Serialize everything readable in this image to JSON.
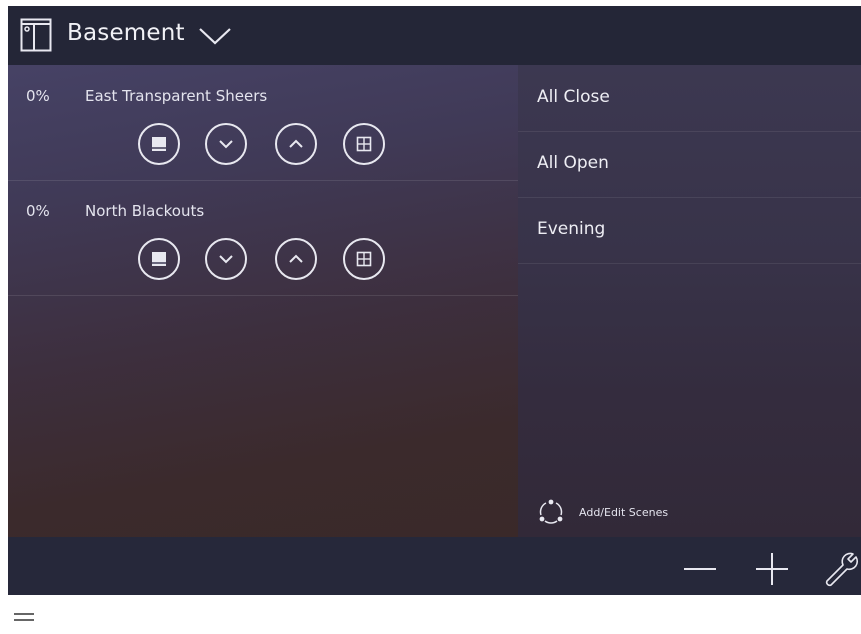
{
  "header": {
    "room_name": "Basement",
    "room_icon": "window-shade-icon",
    "dropdown_icon": "chevron-down-icon"
  },
  "shades": [
    {
      "level": "0%",
      "name": "East Transparent Sheers",
      "controls": [
        "close-icon",
        "lower-icon",
        "raise-icon",
        "open-icon"
      ]
    },
    {
      "level": "0%",
      "name": "North Blackouts",
      "controls": [
        "close-icon",
        "lower-icon",
        "raise-icon",
        "open-icon"
      ]
    }
  ],
  "scenes": {
    "items": [
      {
        "label": "All Close"
      },
      {
        "label": "All Open"
      },
      {
        "label": "Evening"
      }
    ],
    "add_edit_label": "Add/Edit Scenes"
  },
  "footer": {
    "buttons": [
      "minus-icon",
      "plus-icon",
      "wrench-icon"
    ]
  },
  "colors": {
    "header_bg": "#242637",
    "footer_bg": "#26283a",
    "text": "#e8e8f0"
  }
}
